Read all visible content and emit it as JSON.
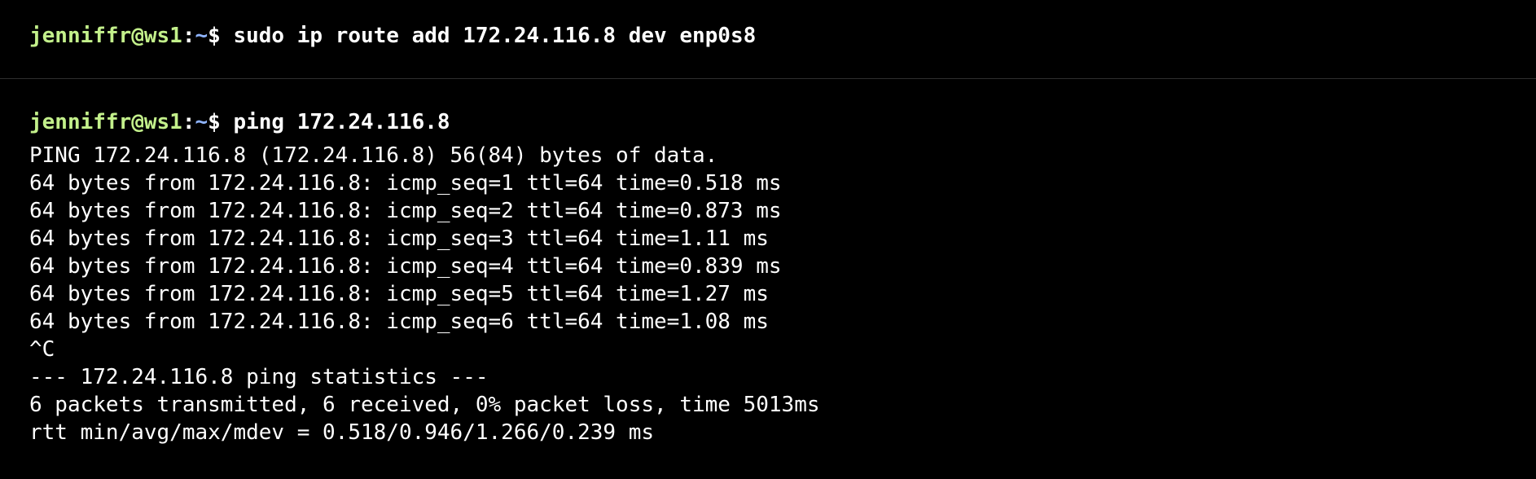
{
  "colors": {
    "background": "#000000",
    "user_host": "#c3f08b",
    "cwd": "#8fb4ff",
    "text": "#ffffff"
  },
  "blocks": [
    {
      "prompt": {
        "user_host": "jenniffr@ws1",
        "separator": ":",
        "cwd": "~",
        "symbol": "$",
        "command": " sudo ip route add 172.24.116.8 dev enp0s8"
      }
    },
    {
      "prompt": {
        "user_host": "jenniffr@ws1",
        "separator": ":",
        "cwd": "~",
        "symbol": "$",
        "command": " ping 172.24.116.8"
      },
      "output": [
        "PING 172.24.116.8 (172.24.116.8) 56(84) bytes of data.",
        "64 bytes from 172.24.116.8: icmp_seq=1 ttl=64 time=0.518 ms",
        "64 bytes from 172.24.116.8: icmp_seq=2 ttl=64 time=0.873 ms",
        "64 bytes from 172.24.116.8: icmp_seq=3 ttl=64 time=1.11 ms",
        "64 bytes from 172.24.116.8: icmp_seq=4 ttl=64 time=0.839 ms",
        "64 bytes from 172.24.116.8: icmp_seq=5 ttl=64 time=1.27 ms",
        "64 bytes from 172.24.116.8: icmp_seq=6 ttl=64 time=1.08 ms",
        "^C",
        "--- 172.24.116.8 ping statistics ---",
        "6 packets transmitted, 6 received, 0% packet loss, time 5013ms",
        "rtt min/avg/max/mdev = 0.518/0.946/1.266/0.239 ms"
      ]
    }
  ]
}
